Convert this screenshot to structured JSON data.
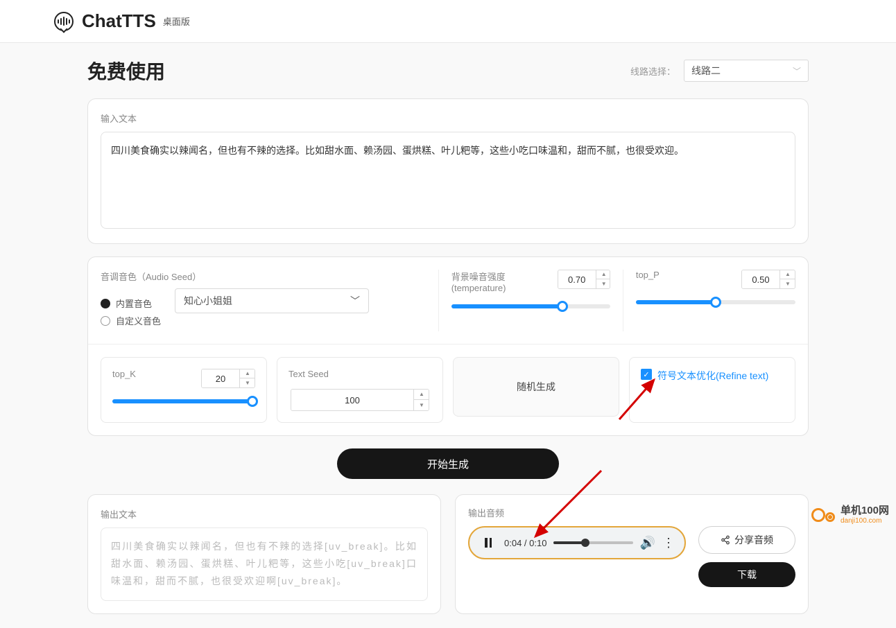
{
  "header": {
    "title": "ChatTTS",
    "subtitle": "桌面版"
  },
  "page_title": "免费使用",
  "route": {
    "label": "线路选择：",
    "value": "线路二"
  },
  "input_text": {
    "label": "输入文本",
    "value": "四川美食确实以辣闻名，但也有不辣的选择。比如甜水面、赖汤园、蛋烘糕、叶儿粑等，这些小吃口味温和，甜而不腻，也很受欢迎。"
  },
  "audio_seed": {
    "label": "音调音色（Audio Seed）",
    "option_builtin": "内置音色",
    "option_custom": "自定义音色",
    "voice": "知心小姐姐"
  },
  "temperature": {
    "label": "背景噪音强度(temperature)",
    "value": "0.70",
    "percent": 70
  },
  "top_p": {
    "label": "top_P",
    "value": "0.50",
    "percent": 50
  },
  "top_k": {
    "label": "top_K",
    "value": "20",
    "percent": 98
  },
  "text_seed": {
    "label": "Text Seed",
    "value": "100"
  },
  "random_btn": "随机生成",
  "refine": {
    "label": "符号文本优化(Refine text)"
  },
  "generate_btn": "开始生成",
  "output_text": {
    "label": "输出文本",
    "value": "四川美食确实以辣闻名，但也有不辣的选择[uv_break]。比如甜水面、赖汤园、蛋烘糕、叶儿粑等，这些小吃[uv_break]口味温和，甜而不腻，也很受欢迎啊[uv_break]。"
  },
  "output_audio": {
    "label": "输出音频",
    "time": "0:04 / 0:10",
    "progress_percent": 40,
    "share": "分享音频",
    "download": "下载"
  },
  "watermark": {
    "name": "单机100网",
    "url": "danji100.com"
  }
}
